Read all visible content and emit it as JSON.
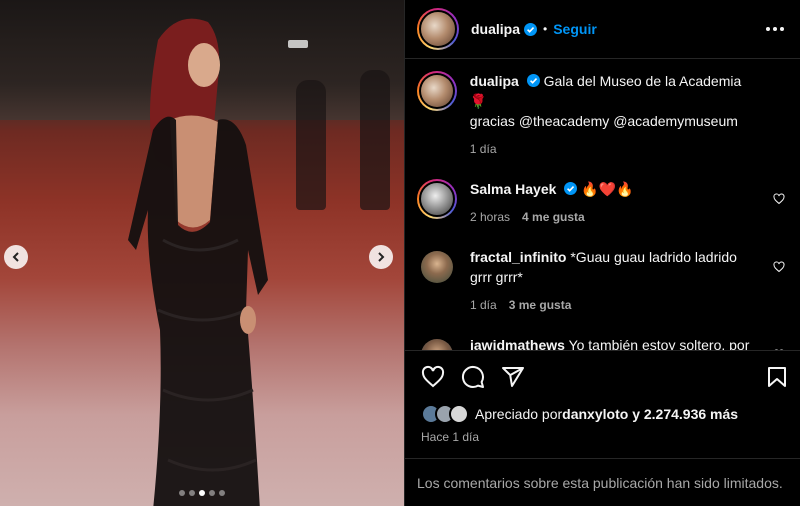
{
  "post": {
    "author": "dualipa",
    "follow_label": "Seguir",
    "separator": "•",
    "carousel": {
      "total": 5,
      "active_index": 3
    }
  },
  "caption": {
    "username": "dualipa",
    "text_line1": "Gala del Museo de la Academia 🌹",
    "text_line2": "gracias @theacademy @academymuseum",
    "time": "1 día"
  },
  "comments": [
    {
      "username": "Salma Hayek",
      "verified": true,
      "text": "🔥❤️🔥",
      "time": "2 horas",
      "likes": "4 me gusta"
    },
    {
      "username": "fractal_infinito",
      "verified": false,
      "text": "*Guau guau ladrido ladrido grrr grrr*",
      "time": "1 día",
      "likes": "3 me gusta"
    },
    {
      "username": "jawidmathews",
      "verified": false,
      "text": "Yo también estoy soltero, por cierto.",
      "time": "",
      "likes": ""
    }
  ],
  "likes": {
    "prefix": "Apreciado por",
    "user": "danxyloto",
    "suffix": "y 2.274.936 más",
    "time": "Hace 1 día"
  },
  "footer": {
    "text": "Los comentarios sobre esta publicación han sido limitados."
  },
  "colors": {
    "link": "#0095f6",
    "verified": "#0095f6",
    "muted": "#a8a8a8",
    "divider": "#262626"
  },
  "icons": [
    "chevron-left-icon",
    "chevron-right-icon",
    "verified-icon",
    "more-icon",
    "heart-icon",
    "comment-icon",
    "share-icon",
    "bookmark-icon"
  ]
}
